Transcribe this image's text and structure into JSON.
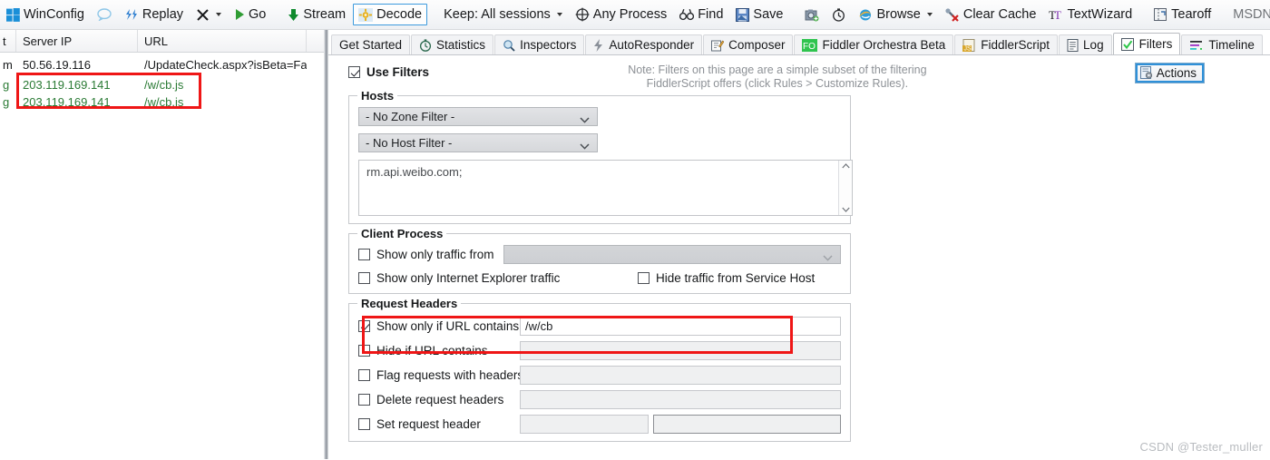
{
  "toolbar": {
    "winconfig": "WinConfig",
    "replay": "Replay",
    "go": "Go",
    "stream": "Stream",
    "decode": "Decode",
    "keep": "Keep: All sessions",
    "any_process": "Any Process",
    "find": "Find",
    "save": "Save",
    "browse": "Browse",
    "clear_cache": "Clear Cache",
    "textwizard": "TextWizard",
    "tearoff": "Tearoff",
    "msdn_search": "MSDN Search..."
  },
  "sessions": {
    "headers": [
      "t",
      "Server IP",
      "URL",
      ""
    ],
    "rows": [
      {
        "c0": "m",
        "ip": "50.56.19.116",
        "url": "/UpdateCheck.aspx?isBeta=Fa...",
        "color": "dark"
      },
      {
        "c0": "g",
        "ip": "203.119.169.141",
        "url": "/w/cb.js",
        "color": "green"
      },
      {
        "c0": "g",
        "ip": "203.119.169.141",
        "url": "/w/cb.js",
        "color": "green"
      }
    ]
  },
  "tabs": [
    {
      "label": "Get Started",
      "icon": "none",
      "active": false
    },
    {
      "label": "Statistics",
      "icon": "stopwatch-icon",
      "active": false
    },
    {
      "label": "Inspectors",
      "icon": "magnifier-icon",
      "active": false
    },
    {
      "label": "AutoResponder",
      "icon": "lightning-icon",
      "active": false
    },
    {
      "label": "Composer",
      "icon": "compose-icon",
      "active": false
    },
    {
      "label": "Fiddler Orchestra Beta",
      "icon": "fo-icon",
      "active": false
    },
    {
      "label": "FiddlerScript",
      "icon": "js-icon",
      "active": false
    },
    {
      "label": "Log",
      "icon": "log-icon",
      "active": false
    },
    {
      "label": "Filters",
      "icon": "check-icon",
      "active": true
    },
    {
      "label": "Timeline",
      "icon": "timeline-icon",
      "active": false
    }
  ],
  "filters": {
    "use_filters_label": "Use Filters",
    "use_filters_checked": true,
    "note_line1": "Note: Filters on this page are a simple subset of the filtering",
    "note_line2": "FiddlerScript offers (click Rules > Customize Rules).",
    "actions_label": "Actions",
    "hosts": {
      "title": "Hosts",
      "zone_filter": "- No Zone Filter -",
      "host_filter": "- No Host Filter -",
      "host_list_value": "rm.api.weibo.com;"
    },
    "client_process": {
      "title": "Client Process",
      "show_only_traffic_from": "Show only traffic from",
      "show_only_traffic_from_checked": false,
      "process_value": "",
      "show_only_ie": "Show only Internet Explorer traffic",
      "show_only_ie_checked": false,
      "hide_service_host": "Hide traffic from Service Host",
      "hide_service_host_checked": false
    },
    "request_headers": {
      "title": "Request Headers",
      "show_only_if_url_contains": "Show only if URL contains",
      "show_only_if_url_contains_checked": true,
      "show_only_if_url_contains_value": "/w/cb",
      "hide_if_url_contains": "Hide if URL contains",
      "hide_if_url_contains_checked": false,
      "hide_if_url_contains_value": "",
      "flag_requests_with_headers": "Flag requests with headers",
      "flag_requests_with_headers_checked": false,
      "flag_requests_value": "",
      "delete_request_headers": "Delete request headers",
      "delete_request_headers_checked": false,
      "delete_request_value": "",
      "set_request_header": "Set request header",
      "set_request_header_checked": false,
      "set_request_name": "",
      "set_request_value": ""
    }
  },
  "watermark": "CSDN @Tester_muller",
  "colors": {
    "accent": "#2f90d8",
    "highlight_box": "#ef1616",
    "green_row": "#2a7a34"
  }
}
